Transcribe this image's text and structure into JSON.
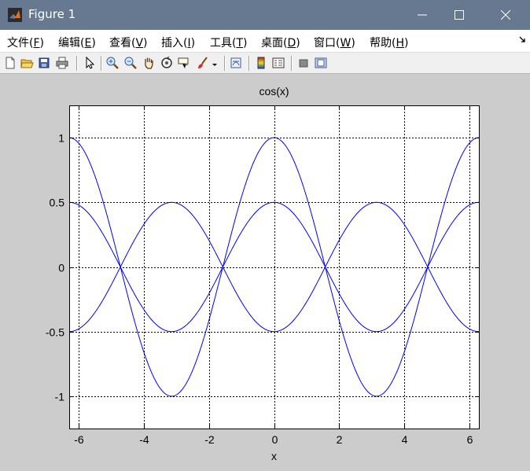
{
  "window": {
    "title": "Figure 1",
    "icon": "matlab-icon",
    "titlebar_color": "#677990"
  },
  "menu": {
    "items": [
      {
        "label": "文件(",
        "acc": "F",
        "end": ")"
      },
      {
        "label": "编辑(",
        "acc": "E",
        "end": ")"
      },
      {
        "label": "查看(",
        "acc": "V",
        "end": ")"
      },
      {
        "label": "插入(",
        "acc": "I",
        "end": ")"
      },
      {
        "label": "工具(",
        "acc": "T",
        "end": ")"
      },
      {
        "label": "桌面(",
        "acc": "D",
        "end": ")"
      },
      {
        "label": "窗口(",
        "acc": "W",
        "end": ")"
      },
      {
        "label": "帮助(",
        "acc": "H",
        "end": ")"
      }
    ]
  },
  "toolbar": {
    "icons": [
      "new-figure-icon",
      "open-file-icon",
      "save-icon",
      "print-icon",
      "select-arrow-icon",
      "zoom-in-icon",
      "zoom-out-icon",
      "pan-hand-icon",
      "rotate-3d-icon",
      "data-cursor-icon",
      "brush-icon",
      "link-plot-icon",
      "insert-colorbar-icon",
      "insert-legend-icon",
      "hide-plot-tools-icon",
      "show-plot-tools-icon"
    ]
  },
  "chart_data": {
    "type": "line",
    "title": "cos(x)",
    "xlabel": "x",
    "ylabel": "",
    "xlim": [
      -6.2832,
      6.2832
    ],
    "ylim": [
      -1.25,
      1.25
    ],
    "xticks": [
      -6,
      -4,
      -2,
      0,
      2,
      4,
      6
    ],
    "yticks": [
      -1,
      -0.5,
      0,
      0.5,
      1
    ],
    "xtick_labels": [
      "-6",
      "-4",
      "-2",
      "0",
      "2",
      "4",
      "6"
    ],
    "ytick_labels": [
      "-1",
      "-0.5",
      "0",
      "0.5",
      "1"
    ],
    "grid": "dotted",
    "line_color": "#0000ff",
    "series": [
      {
        "function": "cos(x)",
        "amplitude": 1,
        "points": [
          [
            -6.2832,
            1
          ],
          [
            -4.7124,
            0
          ],
          [
            -3.1416,
            -1
          ],
          [
            -1.5708,
            0
          ],
          [
            0,
            1
          ],
          [
            1.5708,
            0
          ],
          [
            3.1416,
            -1
          ],
          [
            4.7124,
            0
          ],
          [
            6.2832,
            1
          ]
        ]
      },
      {
        "function": "0.5*cos(x)",
        "amplitude": 0.5,
        "points": [
          [
            -6.2832,
            0.5
          ],
          [
            -4.7124,
            0
          ],
          [
            -3.1416,
            -0.5
          ],
          [
            -1.5708,
            0
          ],
          [
            0,
            0.5
          ],
          [
            1.5708,
            0
          ],
          [
            3.1416,
            -0.5
          ],
          [
            4.7124,
            0
          ],
          [
            6.2832,
            0.5
          ]
        ]
      },
      {
        "function": "-0.5*cos(x)",
        "amplitude": -0.5,
        "points": [
          [
            -6.2832,
            -0.5
          ],
          [
            -4.7124,
            0
          ],
          [
            -3.1416,
            0.5
          ],
          [
            -1.5708,
            0
          ],
          [
            0,
            -0.5
          ],
          [
            1.5708,
            0
          ],
          [
            3.1416,
            0.5
          ],
          [
            4.7124,
            0
          ],
          [
            6.2832,
            -0.5
          ]
        ]
      }
    ]
  }
}
